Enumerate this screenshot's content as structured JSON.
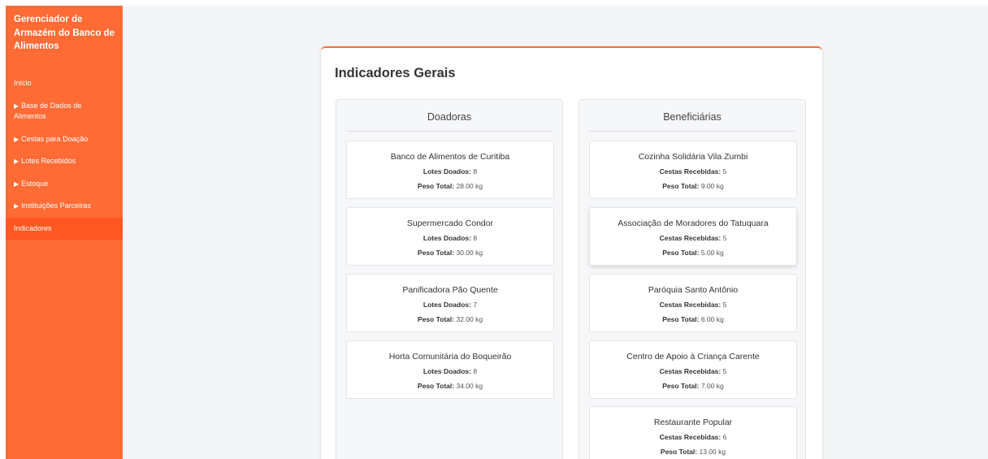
{
  "app": {
    "title": "Gerenciador de Armazém do Banco de Alimentos"
  },
  "sidebar": {
    "items": [
      {
        "label": "Início",
        "has_arrow": false,
        "active": false
      },
      {
        "label": "Base de Dados de Alimentos",
        "has_arrow": true,
        "active": false
      },
      {
        "label": "Cestas para Doação",
        "has_arrow": true,
        "active": false
      },
      {
        "label": "Lotes Recebidos",
        "has_arrow": true,
        "active": false
      },
      {
        "label": "Estoque",
        "has_arrow": true,
        "active": false
      },
      {
        "label": "Instituições Parceiras",
        "has_arrow": true,
        "active": false
      },
      {
        "label": "Indicadores",
        "has_arrow": false,
        "active": true
      }
    ],
    "arrow_glyph": "▶"
  },
  "main": {
    "title": "Indicadores Gerais",
    "donors": {
      "title": "Doadoras",
      "count_label": "Lotes Doados:",
      "weight_label": "Peso Total:",
      "items": [
        {
          "name": "Banco de Alimentos de Curitiba",
          "count": "8",
          "weight": "28.00 kg"
        },
        {
          "name": "Supermercado Condor",
          "count": "8",
          "weight": "30.00 kg"
        },
        {
          "name": "Panificadora Pão Quente",
          "count": "7",
          "weight": "32.00 kg"
        },
        {
          "name": "Horta Comunitária do Boqueirão",
          "count": "8",
          "weight": "34.00 kg"
        }
      ]
    },
    "beneficiaries": {
      "title": "Beneficiárias",
      "count_label": "Cestas Recebidas:",
      "weight_label": "Peso Total:",
      "items": [
        {
          "name": "Cozinha Solidária Vila Zumbi",
          "count": "5",
          "weight": "9.00 kg"
        },
        {
          "name": "Associação de Moradores do Tatuquara",
          "count": "5",
          "weight": "5.00 kg"
        },
        {
          "name": "Paróquia Santo Antônio",
          "count": "5",
          "weight": "6.00 kg"
        },
        {
          "name": "Centro de Apoio à Criança Carente",
          "count": "5",
          "weight": "7.00 kg"
        },
        {
          "name": "Restaurante Popular",
          "count": "6",
          "weight": "13.00 kg"
        }
      ]
    }
  },
  "colors": {
    "accent": "#ff6b35",
    "accent_active": "#ff5722",
    "background": "#f4f5f6"
  }
}
